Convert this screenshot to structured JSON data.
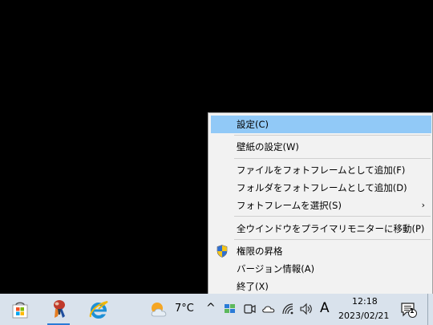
{
  "context_menu": {
    "items": [
      {
        "label": "設定(C)",
        "highlighted": true
      },
      {
        "label": "壁紙の設定(W)"
      },
      {
        "label": "ファイルをフォトフレームとして追加(F)"
      },
      {
        "label": "フォルダをフォトフレームとして追加(D)"
      },
      {
        "label": "フォトフレームを選択(S)",
        "submenu": true,
        "submenu_arrow": "›"
      },
      {
        "label": "全ウインドウをプライマリモニターに移動(P)"
      },
      {
        "label": "権限の昇格",
        "icon": "uac-shield-icon"
      },
      {
        "label": "バージョン情報(A)"
      },
      {
        "label": "終了(X)"
      }
    ]
  },
  "taskbar": {
    "apps": [
      {
        "name": "microsoft-store-icon",
        "active": false
      },
      {
        "name": "app-icon",
        "active": true
      },
      {
        "name": "internet-explorer-icon",
        "active": false
      }
    ],
    "weather": {
      "icon": "partly-cloudy-icon",
      "temperature": "7°C"
    },
    "tray": {
      "chevron": "^",
      "ime_mode": "A",
      "time": "12:18",
      "date": "2023/02/21",
      "notification_count": "1"
    }
  },
  "colors": {
    "menu_background": "#f2f2f2",
    "menu_highlight": "#91c9f7",
    "taskbar_background": "#d9e2ec",
    "desktop_background": "#000000"
  }
}
